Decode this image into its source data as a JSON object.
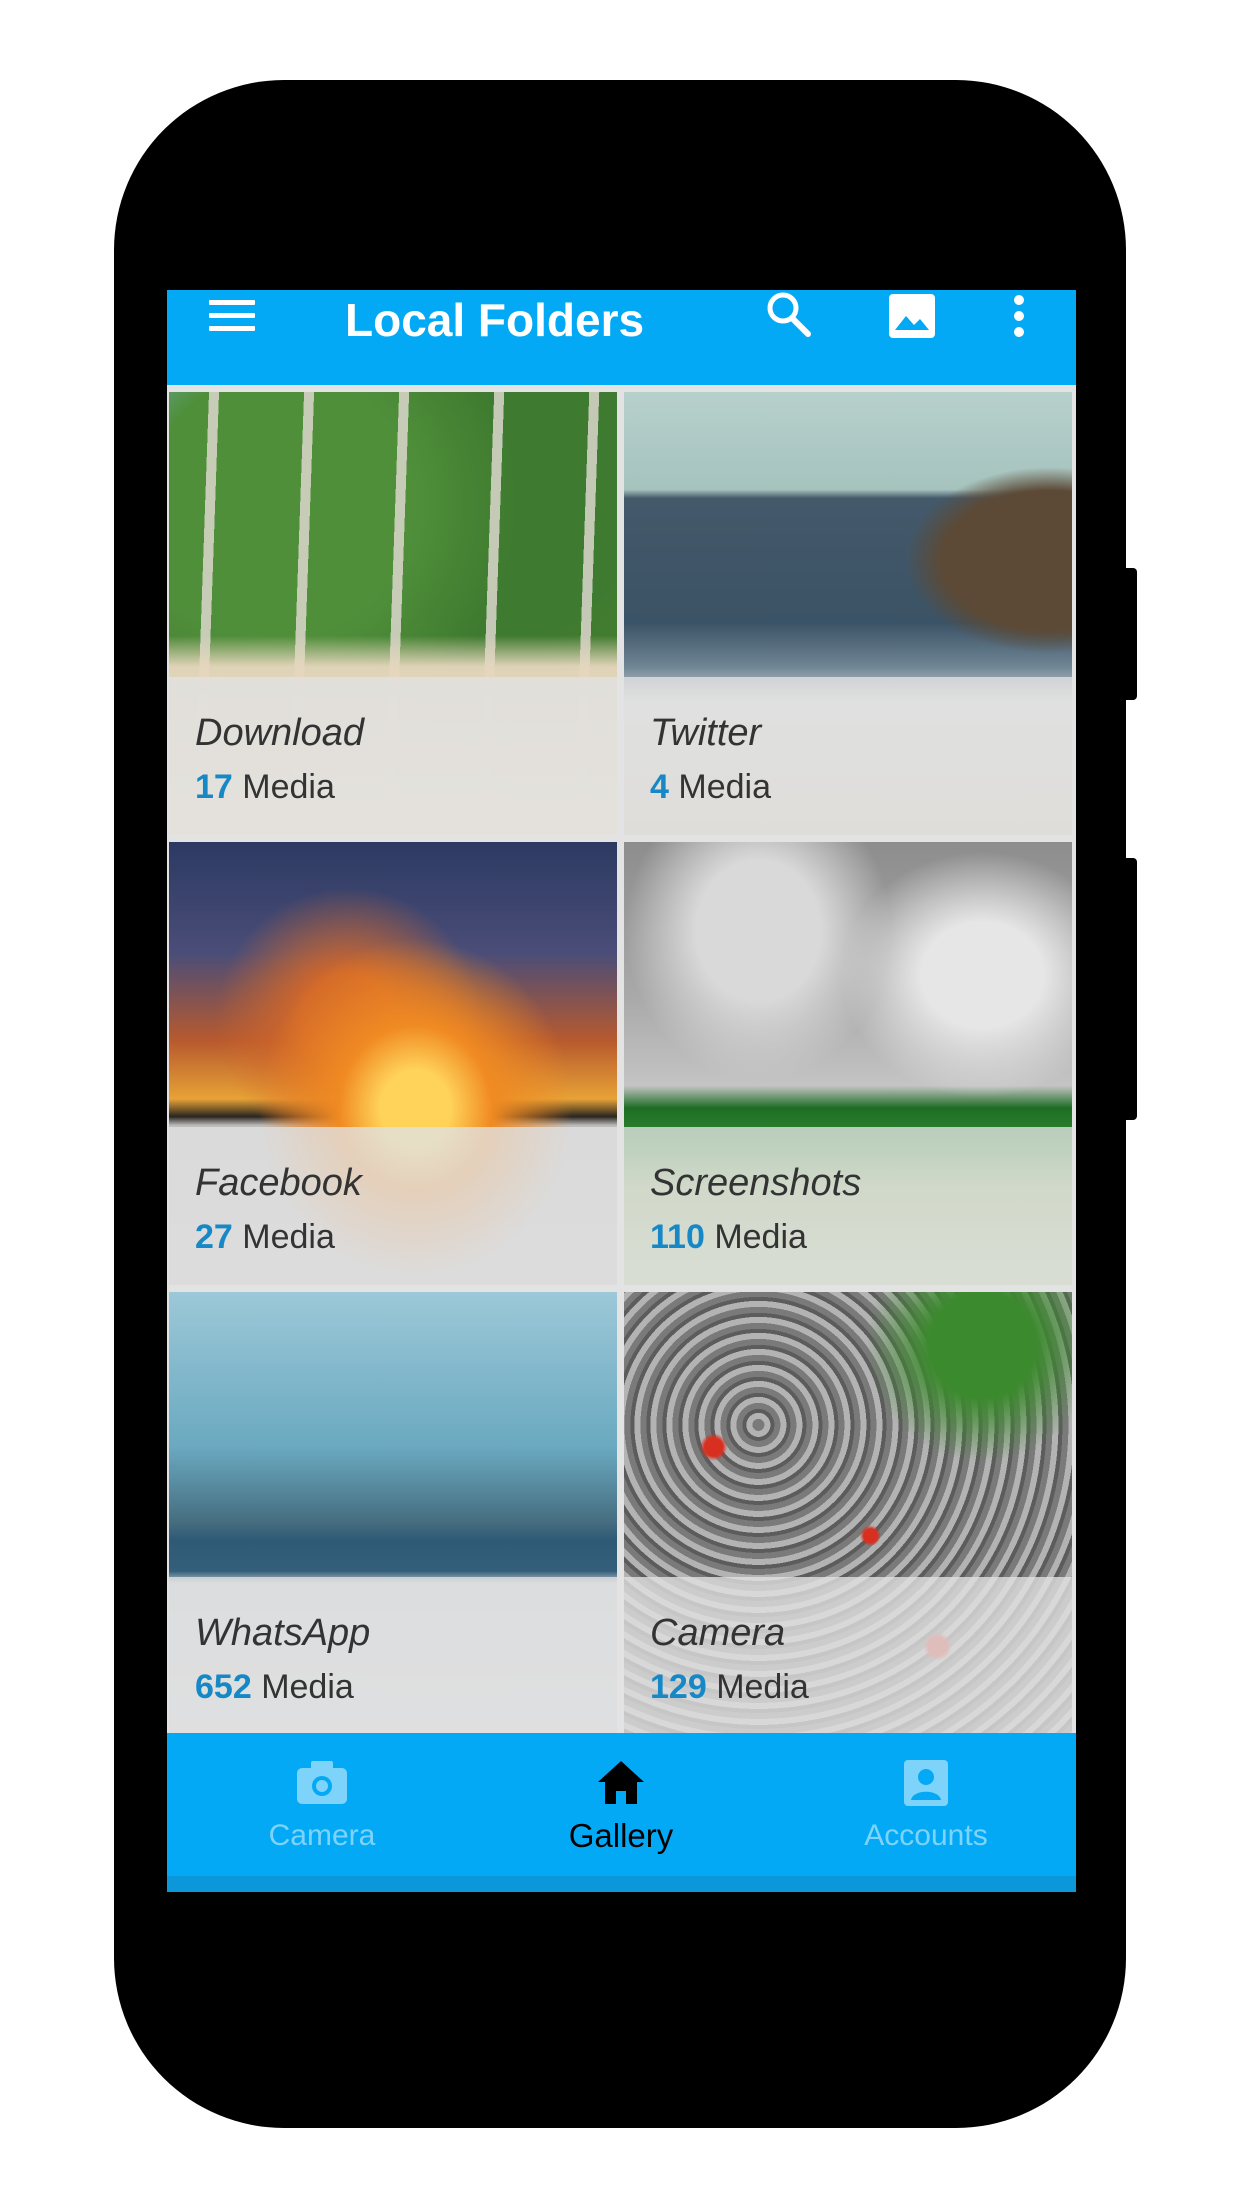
{
  "app_bar": {
    "title": "Local Folders",
    "icons": [
      "menu-icon",
      "search-icon",
      "image-icon",
      "more-vert-icon"
    ],
    "color": "#03a9f4"
  },
  "folders": [
    {
      "name": "Download",
      "count": "17",
      "unit": "Media"
    },
    {
      "name": "Twitter",
      "count": "4",
      "unit": "Media"
    },
    {
      "name": "Facebook",
      "count": "27",
      "unit": "Media"
    },
    {
      "name": "Screenshots",
      "count": "110",
      "unit": "Media"
    },
    {
      "name": "WhatsApp",
      "count": "652",
      "unit": "Media"
    },
    {
      "name": "Camera",
      "count": "129",
      "unit": "Media"
    }
  ],
  "bottom_nav": {
    "items": [
      {
        "label": "Camera",
        "icon": "camera-icon",
        "active": false
      },
      {
        "label": "Gallery",
        "icon": "home-icon",
        "active": true
      },
      {
        "label": "Accounts",
        "icon": "account-box-icon",
        "active": false
      }
    ]
  },
  "colors": {
    "accent": "#03a9f4",
    "count_text": "#1688c6",
    "inactive_nav": "#7ed3fb"
  }
}
